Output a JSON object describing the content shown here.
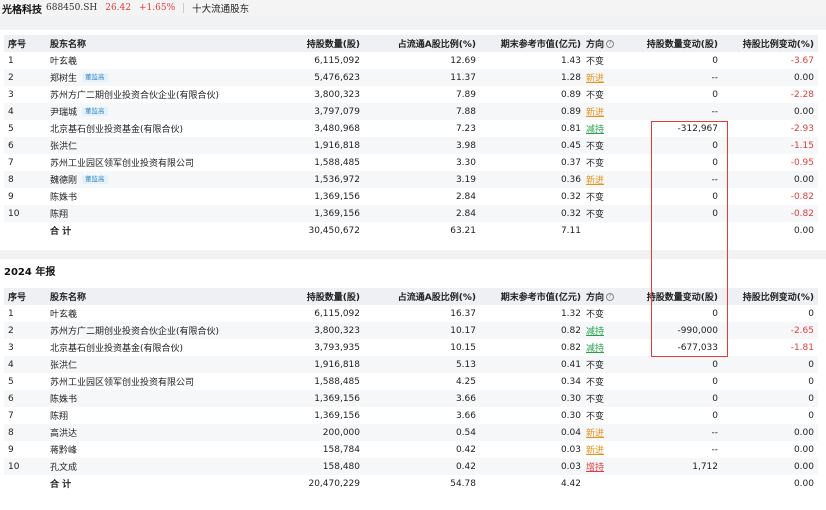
{
  "header": {
    "stock_name": "光格科技",
    "stock_code": "688450.SH",
    "price": "26.42",
    "change_pct": "+1.65%",
    "section": "十大流通股东"
  },
  "columns": [
    "序号",
    "股东名称",
    "持股数量(股)",
    "占流通A股比例(%)",
    "期末参考市值(亿元)",
    "方向",
    "持股数量变动(股)",
    "持股比例变动(%)"
  ],
  "help_icon": "question-circle-icon",
  "colors": {
    "red": "#e03b3b",
    "green": "#22a24a",
    "orange": "#e6931b",
    "tag_blue": "#3b8cc6",
    "highlight_box": "#e53935"
  },
  "current": {
    "rows": [
      {
        "idx": "1",
        "name": "叶玄羲",
        "tag": "",
        "shares": "6,115,092",
        "ratio": "12.69",
        "mv": "1.43",
        "dir": "不变",
        "chg": "0",
        "pchg": "-3.67"
      },
      {
        "idx": "2",
        "name": "郑树生",
        "tag": "董监高",
        "shares": "5,476,623",
        "ratio": "11.37",
        "mv": "1.28",
        "dir": "新进",
        "chg": "--",
        "pchg": "0.00"
      },
      {
        "idx": "3",
        "name": "苏州方广二期创业投资合伙企业(有限合伙)",
        "tag": "",
        "shares": "3,800,323",
        "ratio": "7.89",
        "mv": "0.89",
        "dir": "不变",
        "chg": "0",
        "pchg": "-2.28"
      },
      {
        "idx": "4",
        "name": "尹瑞城",
        "tag": "董监高",
        "shares": "3,797,079",
        "ratio": "7.88",
        "mv": "0.89",
        "dir": "新进",
        "chg": "--",
        "pchg": "0.00"
      },
      {
        "idx": "5",
        "name": "北京基石创业投资基金(有限合伙)",
        "tag": "",
        "shares": "3,480,968",
        "ratio": "7.23",
        "mv": "0.81",
        "dir": "减持",
        "chg": "-312,967",
        "pchg": "-2.93"
      },
      {
        "idx": "6",
        "name": "张洪仁",
        "tag": "",
        "shares": "1,916,818",
        "ratio": "3.98",
        "mv": "0.45",
        "dir": "不变",
        "chg": "0",
        "pchg": "-1.15"
      },
      {
        "idx": "7",
        "name": "苏州工业园区领军创业投资有限公司",
        "tag": "",
        "shares": "1,588,485",
        "ratio": "3.30",
        "mv": "0.37",
        "dir": "不变",
        "chg": "0",
        "pchg": "-0.95"
      },
      {
        "idx": "8",
        "name": "魏德刚",
        "tag": "董监高",
        "shares": "1,536,972",
        "ratio": "3.19",
        "mv": "0.36",
        "dir": "新进",
        "chg": "--",
        "pchg": "0.00"
      },
      {
        "idx": "9",
        "name": "陈姝书",
        "tag": "",
        "shares": "1,369,156",
        "ratio": "2.84",
        "mv": "0.32",
        "dir": "不变",
        "chg": "0",
        "pchg": "-0.82"
      },
      {
        "idx": "10",
        "name": "陈翔",
        "tag": "",
        "shares": "1,369,156",
        "ratio": "2.84",
        "mv": "0.32",
        "dir": "不变",
        "chg": "0",
        "pchg": "-0.82"
      }
    ],
    "total": {
      "label": "合 计",
      "shares": "30,450,672",
      "ratio": "63.21",
      "mv": "7.11",
      "pchg": "0.00"
    }
  },
  "annual": {
    "title": "2024 年报",
    "rows": [
      {
        "idx": "1",
        "name": "叶玄羲",
        "tag": "",
        "shares": "6,115,092",
        "ratio": "16.37",
        "mv": "1.32",
        "dir": "不变",
        "chg": "0",
        "pchg": "0"
      },
      {
        "idx": "2",
        "name": "苏州方广二期创业投资合伙企业(有限合伙)",
        "tag": "",
        "shares": "3,800,323",
        "ratio": "10.17",
        "mv": "0.82",
        "dir": "减持",
        "chg": "-990,000",
        "pchg": "-2.65"
      },
      {
        "idx": "3",
        "name": "北京基石创业投资基金(有限合伙)",
        "tag": "",
        "shares": "3,793,935",
        "ratio": "10.15",
        "mv": "0.82",
        "dir": "减持",
        "chg": "-677,033",
        "pchg": "-1.81"
      },
      {
        "idx": "4",
        "name": "张洪仁",
        "tag": "",
        "shares": "1,916,818",
        "ratio": "5.13",
        "mv": "0.41",
        "dir": "不变",
        "chg": "0",
        "pchg": "0"
      },
      {
        "idx": "5",
        "name": "苏州工业园区领军创业投资有限公司",
        "tag": "",
        "shares": "1,588,485",
        "ratio": "4.25",
        "mv": "0.34",
        "dir": "不变",
        "chg": "0",
        "pchg": "0"
      },
      {
        "idx": "6",
        "name": "陈姝书",
        "tag": "",
        "shares": "1,369,156",
        "ratio": "3.66",
        "mv": "0.30",
        "dir": "不变",
        "chg": "0",
        "pchg": "0"
      },
      {
        "idx": "7",
        "name": "陈翔",
        "tag": "",
        "shares": "1,369,156",
        "ratio": "3.66",
        "mv": "0.30",
        "dir": "不变",
        "chg": "0",
        "pchg": "0"
      },
      {
        "idx": "8",
        "name": "高洪达",
        "tag": "",
        "shares": "200,000",
        "ratio": "0.54",
        "mv": "0.04",
        "dir": "新进",
        "chg": "--",
        "pchg": "0.00"
      },
      {
        "idx": "9",
        "name": "蒋黔峰",
        "tag": "",
        "shares": "158,784",
        "ratio": "0.42",
        "mv": "0.03",
        "dir": "新进",
        "chg": "--",
        "pchg": "0.00"
      },
      {
        "idx": "10",
        "name": "孔文成",
        "tag": "",
        "shares": "158,480",
        "ratio": "0.42",
        "mv": "0.03",
        "dir": "增持",
        "chg": "1,712",
        "pchg": "0.00"
      }
    ],
    "total": {
      "label": "合 计",
      "shares": "20,470,229",
      "ratio": "54.78",
      "mv": "4.42",
      "pchg": "0.00"
    }
  }
}
